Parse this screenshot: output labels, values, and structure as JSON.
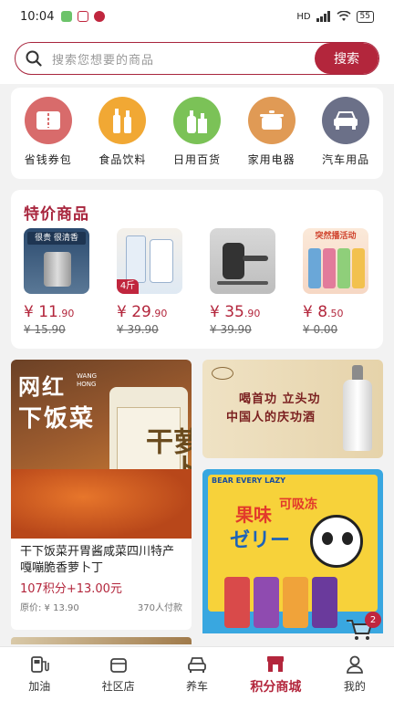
{
  "status": {
    "time": "10:04",
    "battery": "55",
    "network": "HD"
  },
  "search": {
    "placeholder": "搜索您想要的商品",
    "button": "搜索"
  },
  "categories": [
    {
      "label": "省钱券包",
      "icon": "coupon-icon",
      "color": "#d86b6b"
    },
    {
      "label": "食品饮料",
      "icon": "bottles-icon",
      "color": "#f1a834"
    },
    {
      "label": "日用百货",
      "icon": "detergent-icon",
      "color": "#7bc257"
    },
    {
      "label": "家用电器",
      "icon": "pot-icon",
      "color": "#e09a55"
    },
    {
      "label": "汽车用品",
      "icon": "car-icon",
      "color": "#6b7088"
    }
  ],
  "deals": {
    "title": "特价商品",
    "items": [
      {
        "price_int": "¥ 11",
        "price_dec": ".90",
        "old": "¥ 15.90",
        "img_text": "很贵 很清香"
      },
      {
        "price_int": "¥ 29",
        "price_dec": ".90",
        "old": "¥ 39.90",
        "tag": "4斤"
      },
      {
        "price_int": "¥ 35",
        "price_dec": ".90",
        "old": "¥ 39.90"
      },
      {
        "price_int": "¥ 8",
        "price_dec": ".50",
        "old": "¥ 0.00",
        "img_text": "突然播活动"
      }
    ]
  },
  "feed": {
    "left": {
      "overlay_line1": "网红",
      "overlay_brand": "WANG HONG",
      "overlay_line2": "下饭菜",
      "jar_text": "萝卜干",
      "title": "干下饭菜开胃酱咸菜四川特产嘎嘣脆香萝卜丁",
      "price_points": "107积分+13.00元",
      "orig_price": "原价: ¥ 13.90",
      "sold": "370人付款"
    },
    "right_top": {
      "line1": "喝首功 立头功",
      "line2": "中国人的庆功酒"
    },
    "right_bottom": {
      "brand": "BEAR EVERY LAZY",
      "title": "果味",
      "title2": "可吸冻",
      "jp": "ゼリー"
    }
  },
  "cart": {
    "count": "2"
  },
  "tabs": [
    {
      "label": "加油",
      "icon": "gas-station-icon"
    },
    {
      "label": "社区店",
      "icon": "store-icon"
    },
    {
      "label": "养车",
      "icon": "car-care-icon"
    },
    {
      "label": "积分商城",
      "icon": "mall-icon",
      "active": true
    },
    {
      "label": "我的",
      "icon": "user-icon"
    }
  ],
  "colors": {
    "accent": "#b3263c",
    "background": "#f2f2f2"
  }
}
